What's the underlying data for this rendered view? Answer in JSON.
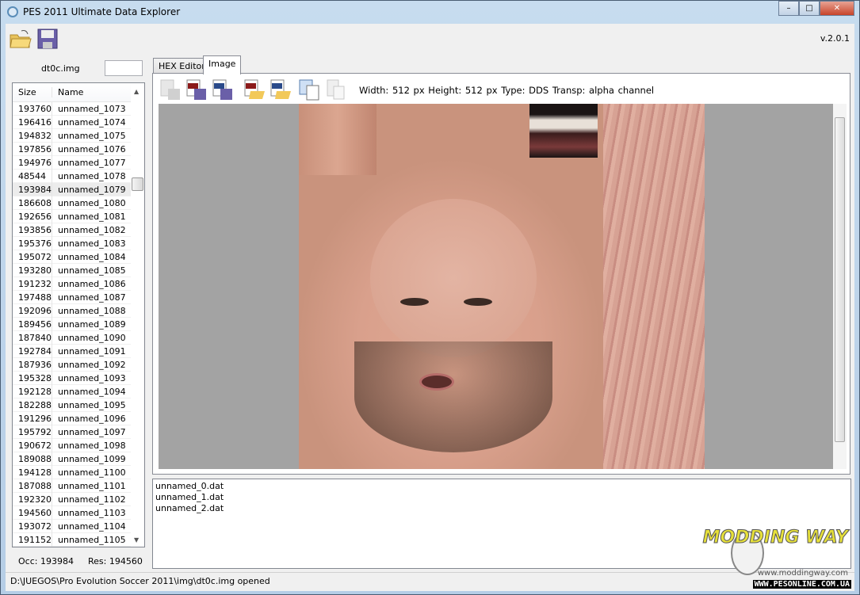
{
  "window": {
    "title": "PES 2011 Ultimate Data Explorer",
    "controls": [
      "minimize",
      "maximize",
      "close"
    ]
  },
  "toolbar": {
    "icons": [
      "open-folder-icon",
      "save-disk-icon"
    ],
    "version": "v.2.0.1"
  },
  "left": {
    "file_name": "dt0c.img",
    "search_value": "",
    "columns": [
      "Size",
      "Name"
    ],
    "rows": [
      [
        "193760",
        "unnamed_1073"
      ],
      [
        "196416",
        "unnamed_1074"
      ],
      [
        "194832",
        "unnamed_1075"
      ],
      [
        "197856",
        "unnamed_1076"
      ],
      [
        "194976",
        "unnamed_1077"
      ],
      [
        "48544",
        "unnamed_1078"
      ],
      [
        "193984",
        "unnamed_1079"
      ],
      [
        "186608",
        "unnamed_1080"
      ],
      [
        "192656",
        "unnamed_1081"
      ],
      [
        "193856",
        "unnamed_1082"
      ],
      [
        "195376",
        "unnamed_1083"
      ],
      [
        "195072",
        "unnamed_1084"
      ],
      [
        "193280",
        "unnamed_1085"
      ],
      [
        "191232",
        "unnamed_1086"
      ],
      [
        "197488",
        "unnamed_1087"
      ],
      [
        "192096",
        "unnamed_1088"
      ],
      [
        "189456",
        "unnamed_1089"
      ],
      [
        "187840",
        "unnamed_1090"
      ],
      [
        "192784",
        "unnamed_1091"
      ],
      [
        "187936",
        "unnamed_1092"
      ],
      [
        "195328",
        "unnamed_1093"
      ],
      [
        "192128",
        "unnamed_1094"
      ],
      [
        "182288",
        "unnamed_1095"
      ],
      [
        "191296",
        "unnamed_1096"
      ],
      [
        "195792",
        "unnamed_1097"
      ],
      [
        "190672",
        "unnamed_1098"
      ],
      [
        "189088",
        "unnamed_1099"
      ],
      [
        "194128",
        "unnamed_1100"
      ],
      [
        "187088",
        "unnamed_1101"
      ],
      [
        "192320",
        "unnamed_1102"
      ],
      [
        "194560",
        "unnamed_1103"
      ],
      [
        "193072",
        "unnamed_1104"
      ],
      [
        "191152",
        "unnamed_1105"
      ]
    ],
    "selected_index": 6,
    "occ": "Occ: 193984",
    "res": "Res: 194560"
  },
  "tabs": [
    {
      "label": "HEX Editor",
      "active": false
    },
    {
      "label": "Image",
      "active": true
    }
  ],
  "image_toolbar": {
    "icons": [
      "export-disabled-icon",
      "save-24bit-icon",
      "save-dds-icon",
      "open-png-icon",
      "open-dds-icon",
      "copy-list-icon",
      "paste-disabled-icon"
    ],
    "info": "Width: 512 px  Height: 512 px  Type: DDS  Transp: alpha channel"
  },
  "output": {
    "lines": [
      "unnamed_0.dat",
      "unnamed_1.dat",
      "unnamed_2.dat"
    ]
  },
  "status": "D:\\JUEGOS\\Pro Evolution Soccer 2011\\img\\dt0c.img opened",
  "watermark": {
    "logo": "MODDING WAY",
    "site1": "www.moddingway.com",
    "site2": "WWW.PESONLINE.COM.UA"
  }
}
